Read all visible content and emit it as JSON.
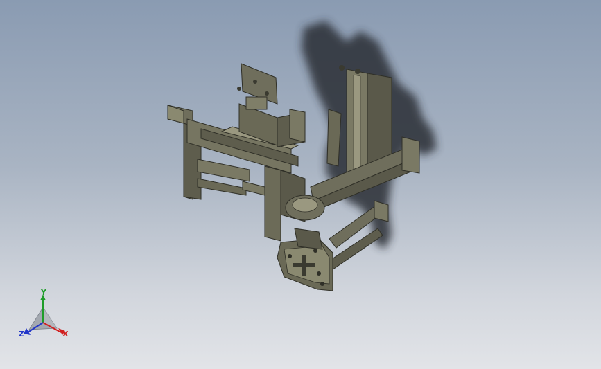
{
  "viewport": {
    "background_top": "#8a9bb2",
    "background_bottom": "#e2e4e8",
    "model_color": "#6f6e5c",
    "model_dark": "#4a4a3c",
    "model_light": "#9a9880",
    "shadow_color": "#2a2d33"
  },
  "triad": {
    "x_label": "X",
    "y_label": "Y",
    "z_label": "Z",
    "x_color": "#d11f1f",
    "y_color": "#1f9d2a",
    "z_color": "#2236c9"
  }
}
